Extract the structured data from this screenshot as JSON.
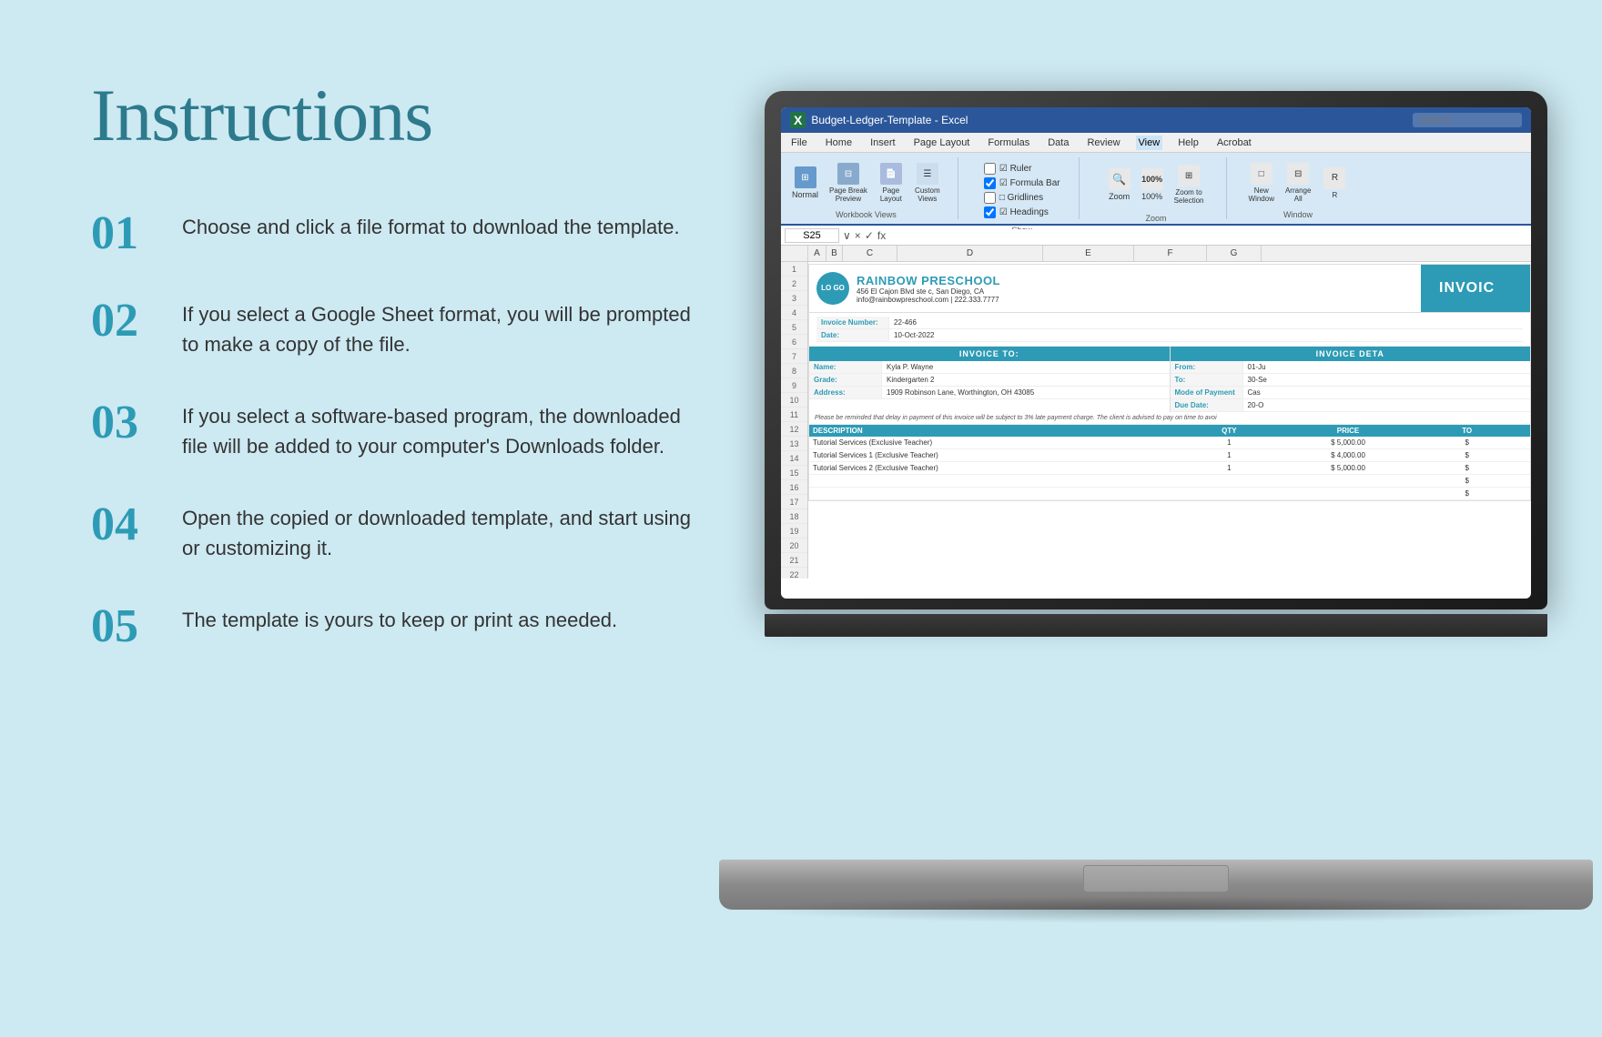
{
  "page": {
    "title": "Instructions",
    "background_color": "#cde9f2",
    "accent_color": "#2d9bb5"
  },
  "instructions": {
    "title": "Instructions",
    "steps": [
      {
        "number": "01",
        "text": "Choose and click a file format to download the template."
      },
      {
        "number": "02",
        "text": "If you select a Google Sheet format, you will be prompted to make a copy of the file."
      },
      {
        "number": "03",
        "text": "If you select a software-based program, the downloaded file will be added to your computer's Downloads folder."
      },
      {
        "number": "04",
        "text": "Open the copied or downloaded template, and start using or customizing it."
      },
      {
        "number": "05",
        "text": "The template is yours to keep or print as needed."
      }
    ]
  },
  "excel": {
    "title_bar": "Budget-Ledger-Template - Excel",
    "search_placeholder": "Search",
    "menu_items": [
      "File",
      "Home",
      "Insert",
      "Page Layout",
      "Formulas",
      "Data",
      "Review",
      "View",
      "Help",
      "Acrobat"
    ],
    "active_tab": "View",
    "ribbon_groups": {
      "workbook_views": {
        "label": "Workbook Views",
        "buttons": [
          "Normal",
          "Page Break Preview",
          "Page Layout",
          "Custom Views"
        ]
      },
      "show": {
        "label": "Show",
        "items": [
          "Ruler",
          "Formula Bar",
          "Gridlines",
          "Headings"
        ]
      },
      "zoom": {
        "label": "Zoom",
        "buttons": [
          "Zoom",
          "100%",
          "Zoom to Selection"
        ]
      },
      "window": {
        "label": "Window",
        "buttons": [
          "New Window",
          "Arrange All",
          "R"
        ]
      }
    },
    "cell_ref": "S25",
    "formula": "fx",
    "invoice": {
      "school_name": "RAINBOW PRESCHOOL",
      "school_address": "456 El Cajon Blvd ste c, San Diego, CA",
      "school_contact": "info@rainbowpreschool.com | 222.333.7777",
      "logo_text": "LO\nGO",
      "invoice_title": "INVOIC",
      "invoice_number_label": "Invoice Number:",
      "invoice_number_value": "22-466",
      "date_label": "Date:",
      "date_value": "10-Oct-2022",
      "invoice_to_header": "INVOICE TO:",
      "invoice_details_header": "INVOICE DETA",
      "name_label": "Name:",
      "name_value": "Kyla P. Wayne",
      "grade_label": "Grade:",
      "grade_value": "Kindergarten 2",
      "address_label": "Address:",
      "address_value": "1909 Robinson Lane, Worthington, OH 43085",
      "from_label": "From:",
      "from_value": "01-Ju",
      "to_label": "To:",
      "to_value": "30-Se",
      "payment_label": "Mode of Payment",
      "payment_value": "Cas",
      "due_label": "Due Date:",
      "due_value": "20-O",
      "notice_text": "Please be reminded that delay in payment of this invoice will be subject to 3% late payment charge. The client is advised to pay on time to avoi",
      "items_header": [
        "DESCRIPTION",
        "QTY",
        "PRICE",
        "TO"
      ],
      "items": [
        {
          "desc": "Tutorial Services (Exclusive Teacher)",
          "qty": "1",
          "price": "$   5,000.00",
          "total": "$"
        },
        {
          "desc": "Tutorial Services 1 (Exclusive Teacher)",
          "qty": "1",
          "price": "$   4,000.00",
          "total": "$"
        },
        {
          "desc": "Tutorial Services 2 (Exclusive Teacher)",
          "qty": "1",
          "price": "$   5,000.00",
          "total": "$"
        }
      ]
    }
  }
}
